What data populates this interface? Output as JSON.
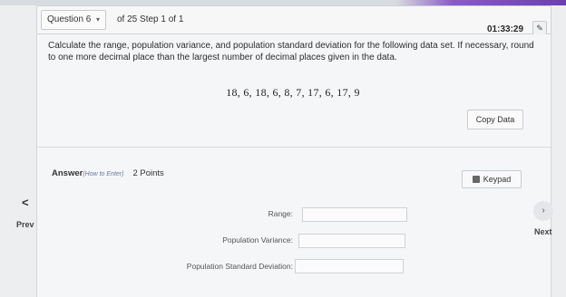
{
  "header": {
    "question_label": "Question 6",
    "step_text": "of 25 Step 1 of 1",
    "timer": "01:33:29"
  },
  "question": {
    "prompt": "Calculate the range, population variance, and population standard deviation for the following data set. If necessary, round to one more decimal place than the largest number of decimal places given in the data.",
    "dataset": "18, 6, 18, 6, 8, 7, 17, 6, 17, 9",
    "copy_label": "Copy Data"
  },
  "answer": {
    "label": "Answer",
    "how_to": "(How to Enter)",
    "points": "2 Points",
    "keypad_label": "Keypad",
    "fields": [
      {
        "label": "Range:",
        "value": ""
      },
      {
        "label": "Population Variance:",
        "value": ""
      },
      {
        "label": "Population Standard Deviation:",
        "value": ""
      }
    ]
  },
  "nav": {
    "prev_label": "Prev",
    "next_label": "Next"
  }
}
